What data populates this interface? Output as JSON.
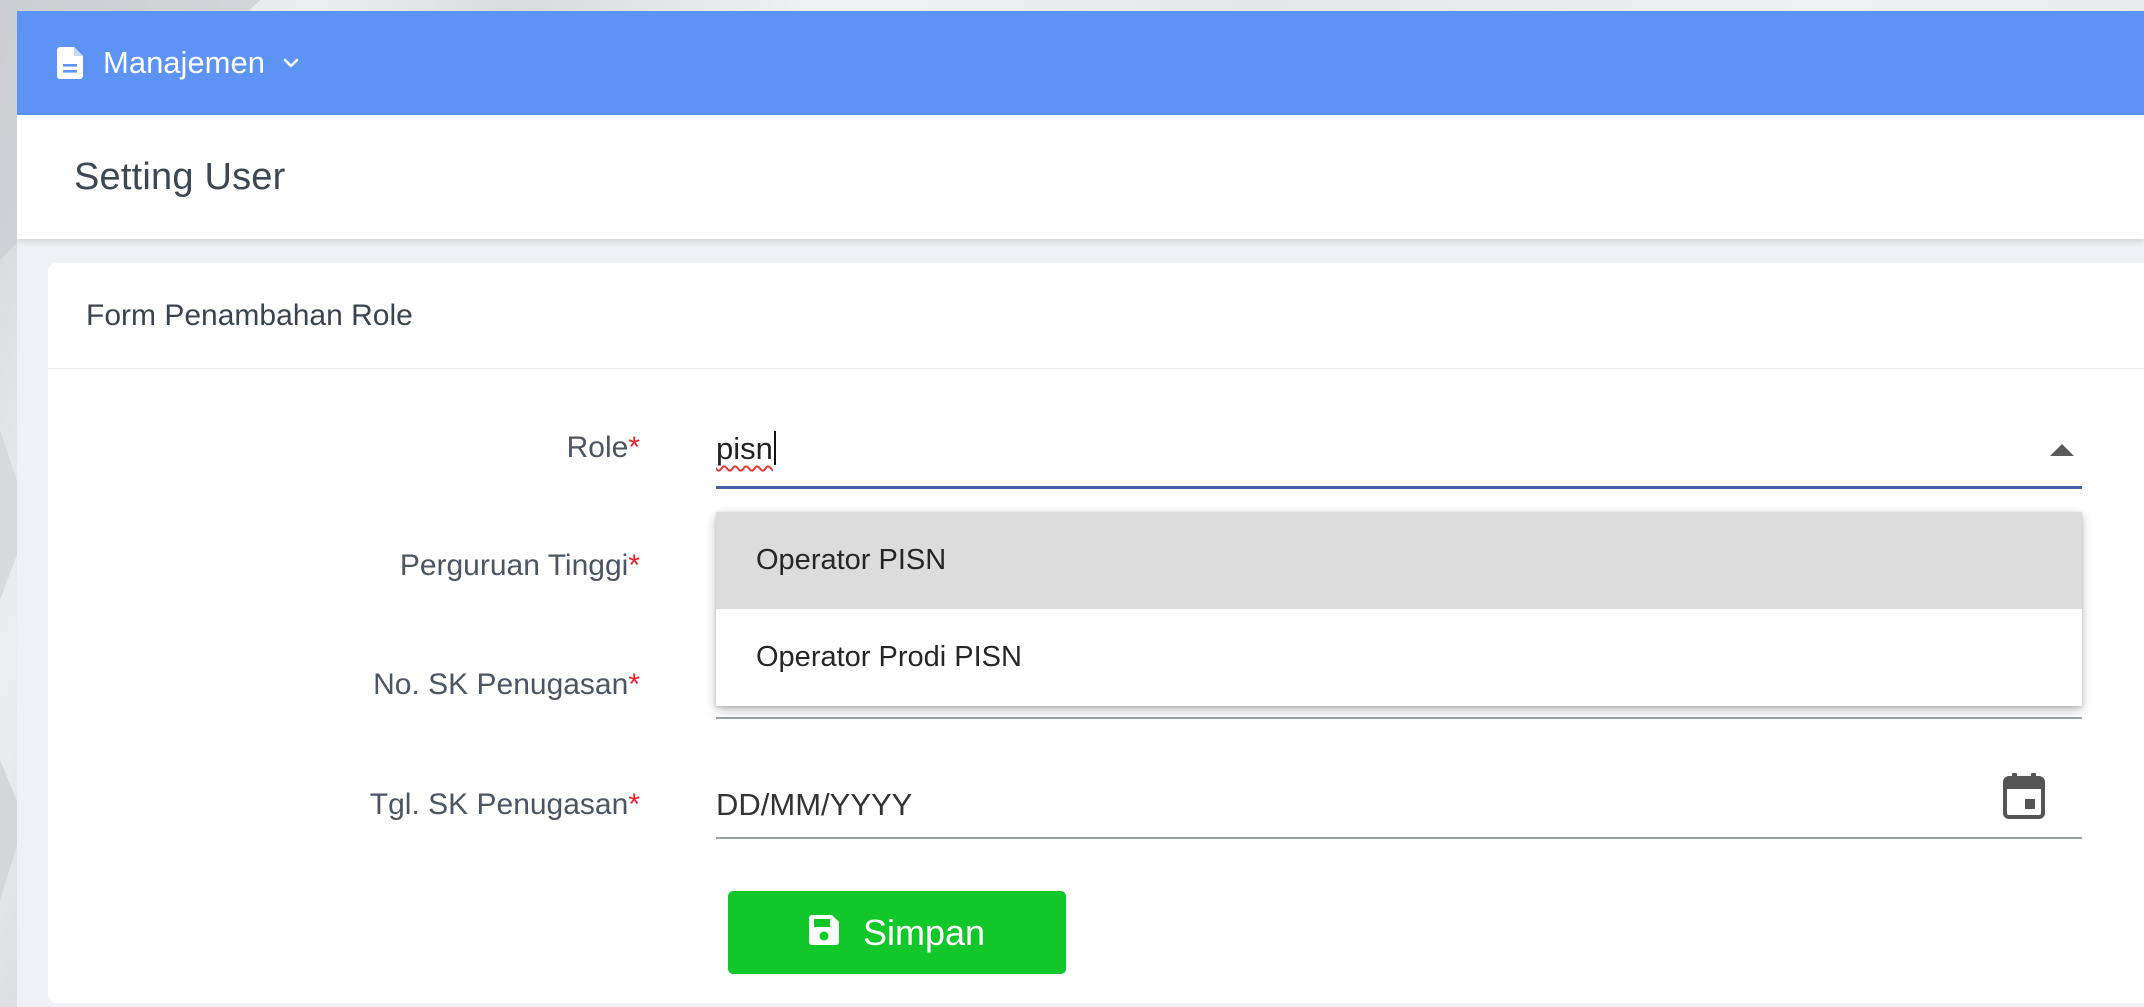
{
  "topbar": {
    "menu_label": "Manajemen",
    "menu_icon": "document-icon",
    "chevron_icon": "chevron-down-icon",
    "background_color": "#5d93f5"
  },
  "header": {
    "title": "Setting User"
  },
  "form": {
    "title": "Form Penambahan Role",
    "required_marker": "*",
    "fields": {
      "role": {
        "label": "Role",
        "value": "pisn",
        "toggle_icon": "caret-up-icon"
      },
      "perguruan_tinggi": {
        "label": "Perguruan Tinggi"
      },
      "no_sk": {
        "label": "No. SK Penugasan"
      },
      "tgl_sk": {
        "label": "Tgl. SK Penugasan",
        "placeholder": "DD/MM/YYYY",
        "icon": "calendar-icon"
      }
    },
    "role_options": [
      {
        "label": "Operator PISN",
        "highlighted": true
      },
      {
        "label": "Operator Prodi PISN",
        "highlighted": false
      }
    ],
    "save_button": {
      "label": "Simpan",
      "icon": "save-icon",
      "color": "#12c729"
    }
  },
  "colors": {
    "required": "#e3262b",
    "active_underline": "#4162a8"
  }
}
